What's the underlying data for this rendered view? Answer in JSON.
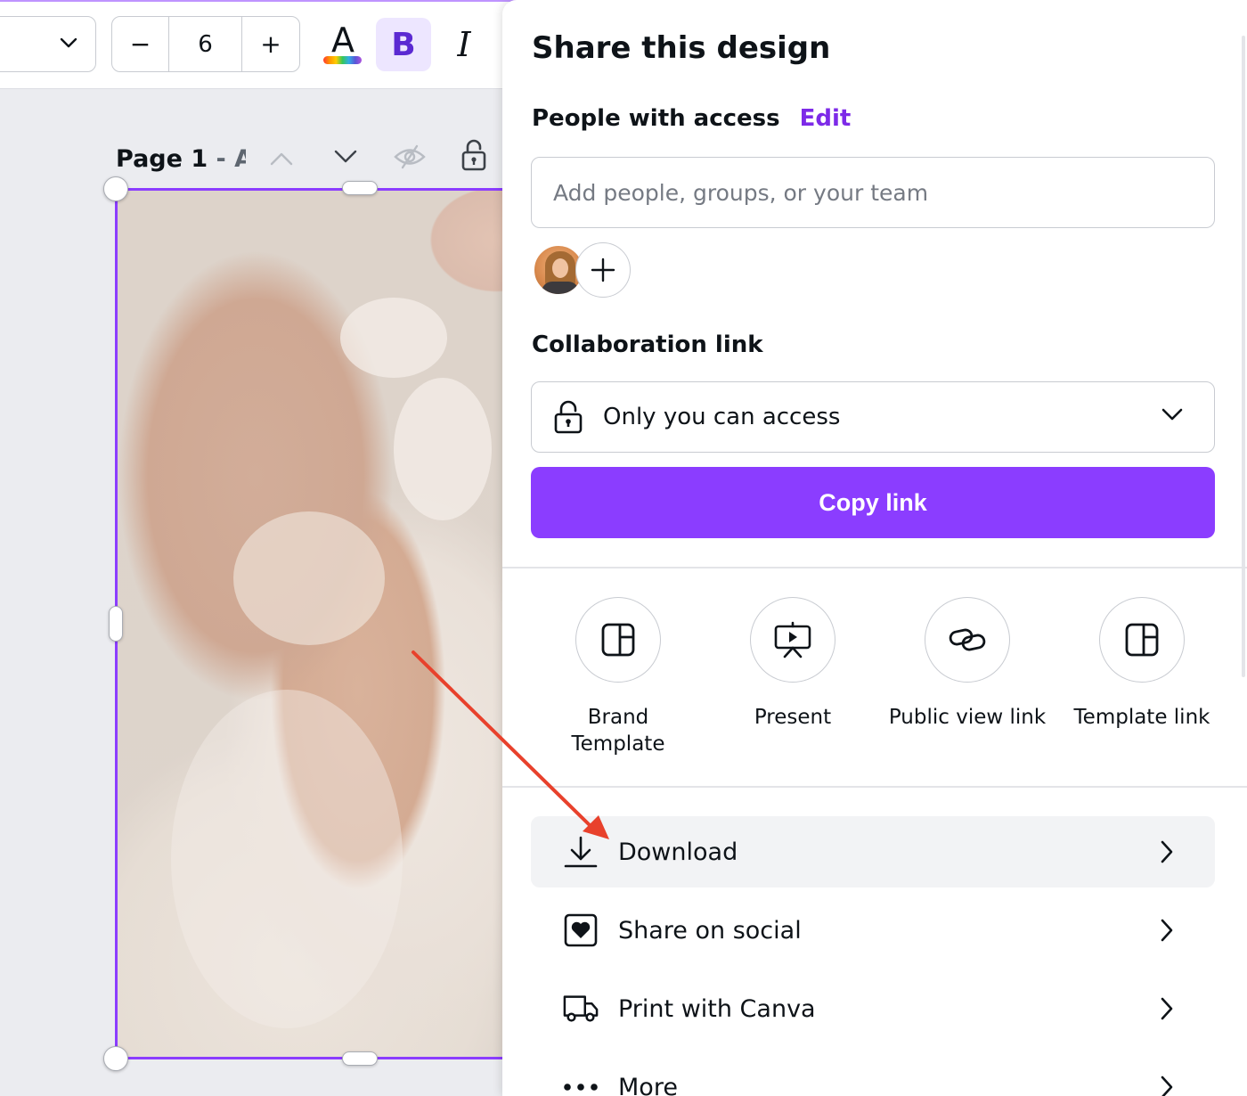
{
  "toolbar": {
    "font_size_value": "6",
    "minus_label": "−",
    "plus_label": "+",
    "text_color_letter": "A",
    "bold_letter": "B",
    "italic_letter": "I",
    "icons": [
      "chevron-down-icon",
      "text-color-icon",
      "bold-icon",
      "italic-icon"
    ],
    "accent": "#8b3dff"
  },
  "canvas": {
    "page_title": "Page 1",
    "page_title_suffix": " - A..",
    "icons": [
      "chevron-up-icon",
      "chevron-down-icon",
      "hide-page-icon",
      "lock-icon"
    ]
  },
  "share_panel": {
    "title": "Share this design",
    "people_label": "People with access",
    "edit_label": "Edit",
    "people_input_placeholder": "Add people, groups, or your team",
    "add_person_label": "+",
    "collab_label": "Collaboration link",
    "collab_value": "Only you can access",
    "copy_link_label": "Copy link",
    "options": [
      {
        "label": "Brand\nTemplate",
        "icon": "brand-template-icon"
      },
      {
        "label": "Present",
        "icon": "present-icon"
      },
      {
        "label": "Public view link",
        "icon": "link-icon"
      },
      {
        "label": "Template link",
        "icon": "template-link-icon"
      }
    ],
    "menu": [
      {
        "label": "Download",
        "icon": "download-icon",
        "highlighted": true
      },
      {
        "label": "Share on social",
        "icon": "social-heart-icon",
        "highlighted": false
      },
      {
        "label": "Print with Canva",
        "icon": "truck-icon",
        "highlighted": false
      },
      {
        "label": "More",
        "icon": "more-dots-icon",
        "highlighted": false
      }
    ],
    "button_color": "#8b3dff",
    "edit_color": "#7d2ae8"
  },
  "annotation": {
    "arrow_color": "#e8412c"
  }
}
